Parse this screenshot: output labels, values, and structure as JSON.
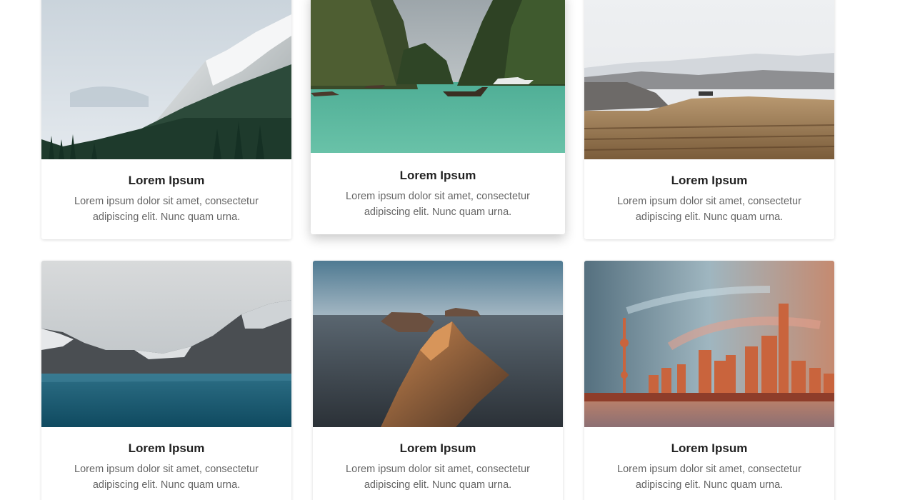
{
  "cards": [
    {
      "title": "Lorem Ipsum",
      "text": "Lorem ipsum dolor sit amet, consectetur adipiscing elit. Nunc quam urna.",
      "image": "mountain-forest-image"
    },
    {
      "title": "Lorem Ipsum",
      "text": "Lorem ipsum dolor sit amet, consectetur adipiscing elit. Nunc quam urna.",
      "image": "tropical-bay-boats-image"
    },
    {
      "title": "Lorem Ipsum",
      "text": "Lorem ipsum dolor sit amet, consectetur adipiscing elit. Nunc quam urna.",
      "image": "plains-snowy-hills-image"
    },
    {
      "title": "Lorem Ipsum",
      "text": "Lorem ipsum dolor sit amet, consectetur adipiscing elit. Nunc quam urna.",
      "image": "mountain-lake-image"
    },
    {
      "title": "Lorem Ipsum",
      "text": "Lorem ipsum dolor sit amet, consectetur adipiscing elit. Nunc quam urna.",
      "image": "coastal-cliffs-sunset-image"
    },
    {
      "title": "Lorem Ipsum",
      "text": "Lorem ipsum dolor sit amet, consectetur adipiscing elit. Nunc quam urna.",
      "image": "city-skyline-sunset-image"
    }
  ],
  "colors": {
    "title": "#222222",
    "text": "#666666",
    "background": "#ffffff"
  }
}
